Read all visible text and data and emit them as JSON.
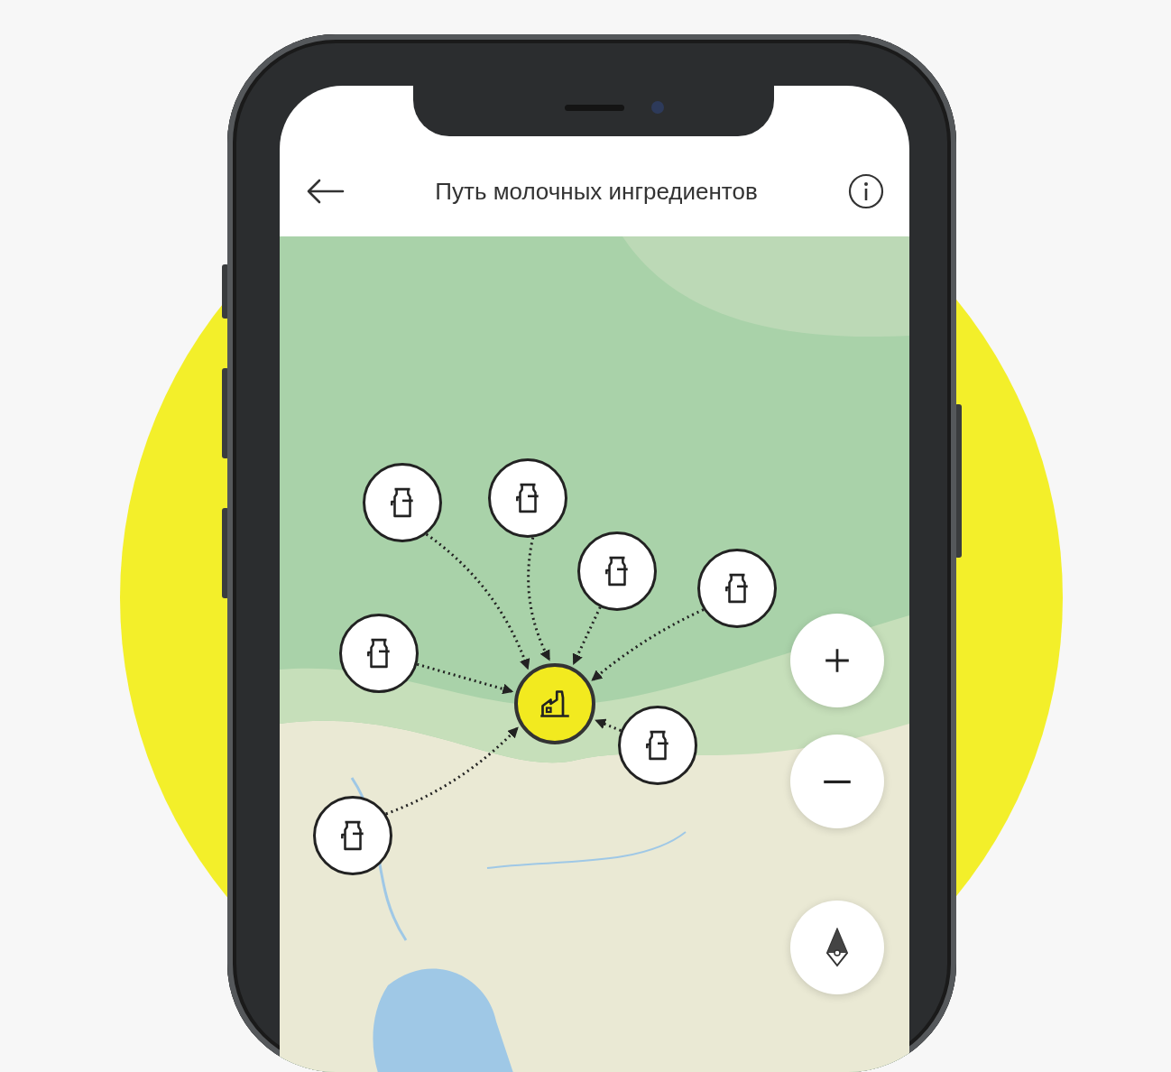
{
  "header": {
    "title": "Путь молочных ингредиентов"
  },
  "map": {
    "markers": [
      {
        "kind": "farm"
      },
      {
        "kind": "farm"
      },
      {
        "kind": "farm"
      },
      {
        "kind": "farm"
      },
      {
        "kind": "farm"
      },
      {
        "kind": "farm"
      },
      {
        "kind": "farm"
      },
      {
        "kind": "factory"
      }
    ]
  },
  "controls": [
    {
      "kind": "zoom_in"
    },
    {
      "kind": "zoom_out"
    },
    {
      "kind": "locate"
    }
  ]
}
